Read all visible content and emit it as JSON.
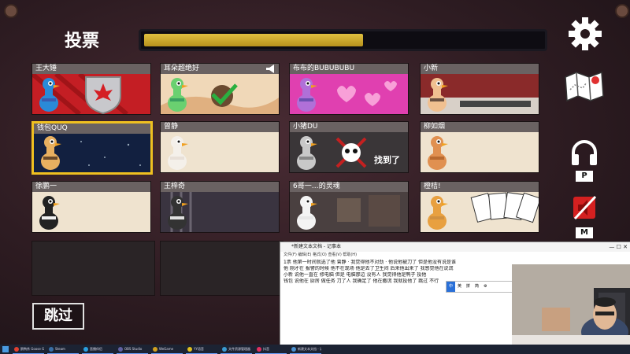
{
  "vote": {
    "title": "投票",
    "progress": 0.55
  },
  "skip_label": "跳过",
  "players": [
    {
      "name": "王大锤",
      "theme": "canada"
    },
    {
      "name": "耳朵超绝好",
      "theme": "desert",
      "has_megaphone": true
    },
    {
      "name": "布布的BUBUBUBU",
      "theme": "hearts"
    },
    {
      "name": "小新",
      "theme": "workshop"
    },
    {
      "name": "钱包QUQ",
      "theme": "space",
      "selected": true
    },
    {
      "name": "曾静",
      "theme": "plain"
    },
    {
      "name": "小猪DU",
      "theme": "dead",
      "status": "找到了"
    },
    {
      "name": "柳如烟",
      "theme": "plain"
    },
    {
      "name": "徐鹏一",
      "theme": "plain"
    },
    {
      "name": "王梓奇",
      "theme": "prison"
    },
    {
      "name": "6哥一…的灵魂",
      "theme": "lab"
    },
    {
      "name": "橙桔!",
      "theme": "cards"
    }
  ],
  "keys": {
    "push_to_talk": "P",
    "mute": "M"
  },
  "icons": {
    "settings": "gear-icon",
    "map": "map-icon",
    "headset": "headphones-icon",
    "muted": "muted-speaker-icon",
    "megaphone": "megaphone-icon"
  },
  "notepad": {
    "title": "*新建文本文档 - 记事本",
    "menu": "文件(F)  编辑(E)  格式(O)  查看(V)  帮助(H)",
    "lines": [
      "1票 他第一时间就选了他 曾静 · 我觉得他不对劲 · 他说他被刀了 但是他没有说是谁",
      "他 刚才在 报警的时候 他不在现场 他是去了卫生间 后来他出来了 我感觉他在说谎",
      "小新 说他一直在 修电脑 但是 电脑那边 没有人 我觉得他是鸭子 投他",
      "钱包 说他在 厨房 做任务 刀了人 我确定了 他在撒谎 我就投他了 跳过 不行"
    ]
  },
  "ime": {
    "items": [
      "中",
      "英",
      "拼",
      "简",
      "⚙"
    ]
  },
  "taskbar": {
    "items": [
      {
        "label": "鹅鸭杀 Goose Goose Duck",
        "color": "#e04030"
      },
      {
        "label": "Steam",
        "color": "#3a6ea5"
      },
      {
        "label": "直播伴侣",
        "color": "#2aa0e0"
      },
      {
        "label": "OBS Studio",
        "color": "#6060a0"
      },
      {
        "label": "WeGame",
        "color": "#d0a020"
      },
      {
        "label": "YY语音",
        "color": "#e0c020"
      },
      {
        "label": "文件资源管理器",
        "color": "#3a9ad0"
      },
      {
        "label": "抖音",
        "color": "#e03060"
      },
      {
        "label": "新建文本文档 - 记事本",
        "color": "#4a90d0"
      }
    ]
  }
}
